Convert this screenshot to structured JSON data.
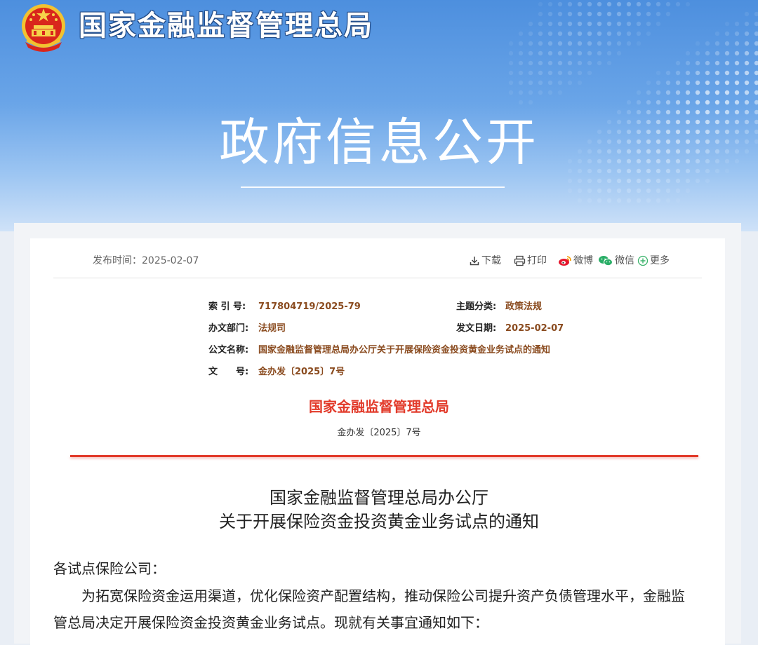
{
  "header": {
    "site_title": "国家金融监督管理总局",
    "banner_title": "政府信息公开"
  },
  "article": {
    "publish_time": "发布时间：2025-02-07",
    "tools": {
      "download": "下载",
      "print": "打印",
      "weibo": "微博",
      "wechat": "微信",
      "more": "更多"
    },
    "meta": {
      "index_label": "索 引 号:",
      "index_value": "717804719/2025-79",
      "category_label": "主题分类:",
      "category_value": "政策法规",
      "dept_label": "办文部门:",
      "dept_value": "法规司",
      "date_label": "发文日期:",
      "date_value": "2025-02-07",
      "doc_name_label": "公文名称:",
      "doc_name_value": "国家金融监督管理总局办公厅关于开展保险资金投资黄金业务试点的通知",
      "doc_no_label": "文　　号:",
      "doc_no_value": "金办发〔2025〕7号"
    },
    "issuer": "国家金融监督管理总局",
    "doc_number": "金办发〔2025〕7号",
    "title_line1": "国家金融监督管理总局办公厅",
    "title_line2": "关于开展保险资金投资黄金业务试点的通知",
    "salutation": "各试点保险公司：",
    "body_line1": "为拓宽保险资金运用渠道，优化保险资产配置结构，推动保险公司提升资产负债管理水平，金融监",
    "body_line2": "管总局决定开展保险资金投资黄金业务试点。现就有关事宜通知如下："
  },
  "colors": {
    "header_blue": "#4d8fde",
    "accent_red": "#e23a2a",
    "meta_value_brown": "#8a4b1f"
  }
}
